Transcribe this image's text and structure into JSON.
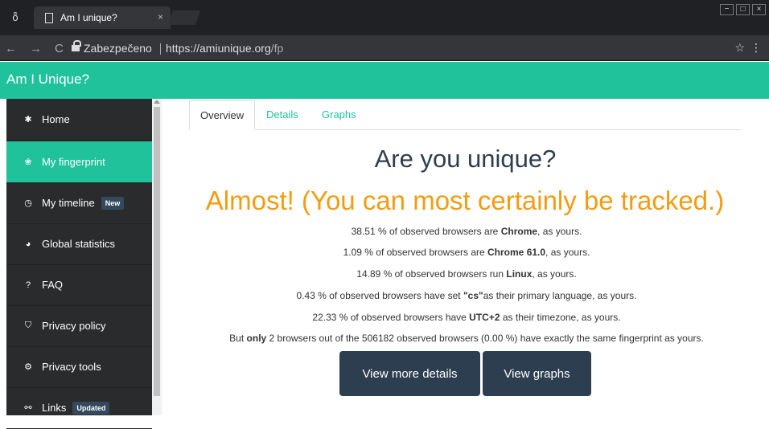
{
  "browser": {
    "tab_title": "Am I unique?",
    "tab_close": "×",
    "window_buttons": [
      "−",
      "□",
      "×"
    ],
    "secure_label": "Zabezpečeno",
    "url_base": "https://amiunique.org",
    "url_path": "/fp",
    "nav": {
      "back": "←",
      "forward": "→",
      "reload": "C"
    },
    "star": "☆",
    "menu": "⋮",
    "incognito_icon": "incognito-icon"
  },
  "site": {
    "title": "Am I Unique?"
  },
  "sidebar": {
    "items": [
      {
        "label": "Home",
        "icon": "✱",
        "active": false,
        "badge": ""
      },
      {
        "label": "My fingerprint",
        "icon": "❀",
        "active": true,
        "badge": ""
      },
      {
        "label": "My timeline",
        "icon": "◷",
        "active": false,
        "badge": "New"
      },
      {
        "label": "Global statistics",
        "icon": "◕",
        "active": false,
        "badge": ""
      },
      {
        "label": "FAQ",
        "icon": "?",
        "active": false,
        "badge": ""
      },
      {
        "label": "Privacy policy",
        "icon": "⛉",
        "active": false,
        "badge": ""
      },
      {
        "label": "Privacy tools",
        "icon": "⚙",
        "active": false,
        "badge": ""
      },
      {
        "label": "Links",
        "icon": "⚯",
        "active": false,
        "badge": "Updated"
      }
    ]
  },
  "tabs": [
    "Overview",
    "Details",
    "Graphs"
  ],
  "heading": "Are you unique?",
  "verdict": "Almost! (You can most certainly be tracked.)",
  "stats": [
    {
      "pre": "38.51 % of observed browsers are ",
      "bold": "Chrome",
      "post": ", as yours."
    },
    {
      "pre": "1.09 % of observed browsers are ",
      "bold": "Chrome 61.0",
      "post": ", as yours."
    },
    {
      "pre": "14.89 % of observed browsers run ",
      "bold": "Linux",
      "post": ", as yours."
    },
    {
      "pre": "0.43 % of observed browsers have set ",
      "bold": "\"cs\"",
      "post": "as their primary language, as yours."
    },
    {
      "pre": "22.33 % of observed browsers have ",
      "bold": "UTC+2",
      "post": " as their timezone, as yours."
    },
    {
      "pre": "But ",
      "bold": "only",
      "post": " 2 browsers out of the 506182 observed browsers (0.00 %) have exactly the same fingerprint as yours."
    }
  ],
  "buttons": {
    "details": "View more details",
    "graphs": "View graphs"
  },
  "colors": {
    "accent": "#20c29c",
    "verdict": "#f39c12",
    "dark": "#2c3e50",
    "sidebar": "#2a2b2d"
  }
}
